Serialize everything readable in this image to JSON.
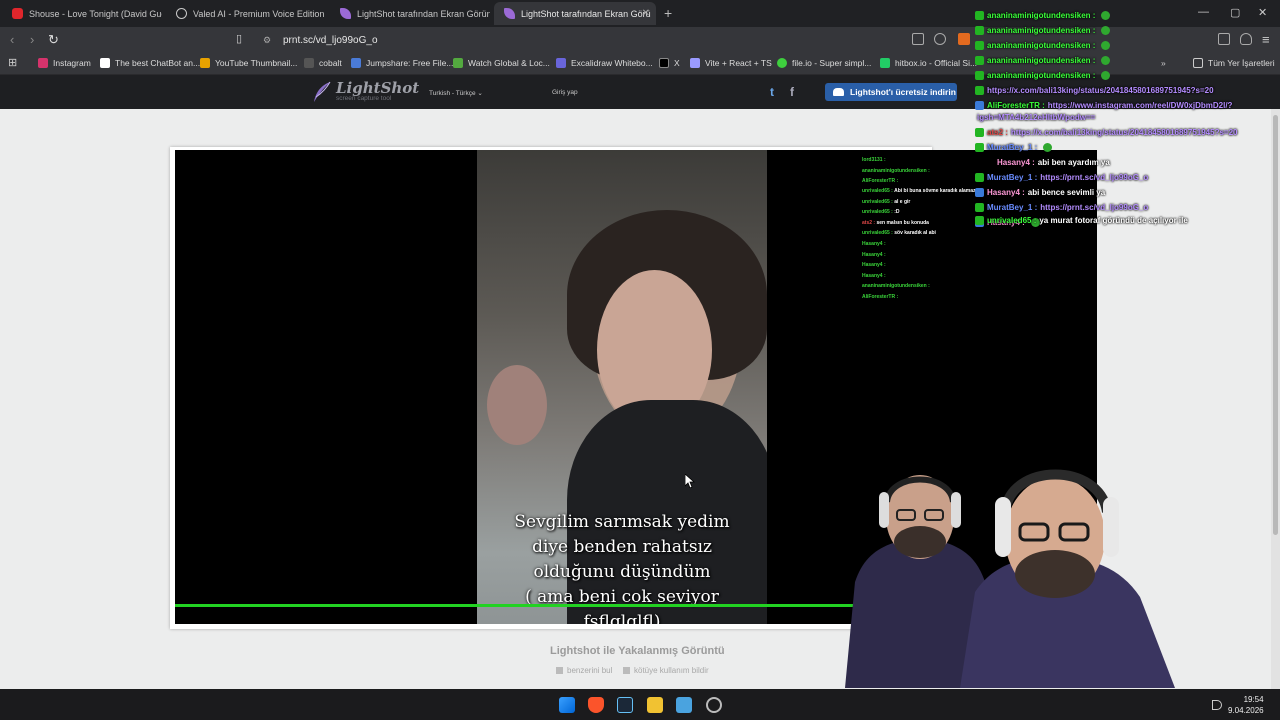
{
  "tabs": [
    {
      "title": "Shouse - Love Tonight (David Guetta",
      "color": "#e0262c"
    },
    {
      "title": "Valed AI - Premium Voice Edition",
      "color": "#c9c9c9"
    },
    {
      "title": "LightShot tarafından Ekran Görüntüs",
      "color": "#9b6ad6"
    },
    {
      "title": "LightShot tarafından Ekran Görü",
      "color": "#9b6ad6"
    }
  ],
  "url": "prnt.sc/vd_ljo99oG_o",
  "bookmarks": [
    {
      "label": "Instagram",
      "color": "#d6336c"
    },
    {
      "label": "The best ChatBot an...",
      "color": "#ffffff"
    },
    {
      "label": "YouTube Thumbnail...",
      "color": "#e8a200"
    },
    {
      "label": "cobalt",
      "color": "#222222"
    },
    {
      "label": "Jumpshare: Free File...",
      "color": "#4a7bd8"
    },
    {
      "label": "Watch Global & Loc...",
      "color": "#53a93f"
    },
    {
      "label": "Excalidraw Whitebo...",
      "color": "#6965db"
    },
    {
      "label": "X",
      "color": "#000000"
    },
    {
      "label": "Vite + React + TS",
      "color": "#9a9aff"
    },
    {
      "label": "file.io - Super simpl...",
      "color": "#3ecf3e"
    },
    {
      "label": "hitbox.io - Official Si...",
      "color": "#22cc66"
    }
  ],
  "all_bookmarks": "Tüm Yer İşaretleri",
  "lightshot": {
    "logo_name": "LightShot",
    "logo_tagline": "screen capture tool",
    "language": "Turkish - Türkçe",
    "login": "Giriş yap",
    "download": "Lightshot'ı ücretsiz indirin",
    "caption": "Lightshot ile Yakalanmış Görüntü",
    "similar": "benzerini bul",
    "report": "kötüye kullanım bildir"
  },
  "subtitle": [
    "Sevgilim sarımsak yedim",
    "diye benden rahatsız",
    "olduğunu düşündüm",
    "( ama beni cok seviyor",
    "fsflglglfl)"
  ],
  "mini_chat": [
    {
      "name": "lord3131 :"
    },
    {
      "name": "ananinaminigotundensiken :"
    },
    {
      "name": "AliForesterTR :"
    },
    {
      "name": "unrivaled65 :",
      "text": "Abi bi buna sövme karadık alamazsın"
    },
    {
      "name": "unrivaled65 :",
      "text": "al e gir"
    },
    {
      "name": "unrivaled65 :",
      "text": ":D"
    },
    {
      "name": "ats2 :",
      "text": "sen malsın bu konuda"
    },
    {
      "name": "unrivaled65 :",
      "text": "söv karadık al abi"
    },
    {
      "name": "Hasany4 :"
    },
    {
      "name": "Hasany4 :"
    },
    {
      "name": "Hasany4 :"
    },
    {
      "name": "Hasany4 :"
    },
    {
      "name": "ananinaminigotundensiken :"
    },
    {
      "name": "AliForesterTR :"
    }
  ],
  "chat": [
    {
      "name": "ananinaminigotundensiken :",
      "text": ""
    },
    {
      "name": "ananinaminigotundensiken :",
      "text": ""
    },
    {
      "name": "ananinaminigotundensiken :",
      "text": ""
    },
    {
      "name": "ananinaminigotundensiken :",
      "text": ""
    },
    {
      "name": "ananinaminigotundensiken :",
      "text": ""
    },
    {
      "name": "",
      "text": "https://x.com/bali13king/status/2041845801689751945?s=20"
    },
    {
      "name": "AliForesterTR :",
      "text": "https://www.instagram.com/reel/DW0xjDbmD2l/?"
    },
    {
      "name": "",
      "text": "igsh=MTA4b212eHltbWpodw=="
    },
    {
      "name": "ats2 :",
      "text": "https://x.com/bali13king/status/2041845801689751945?s=20"
    },
    {
      "name": "MuratBey_1 :",
      "text": ""
    },
    {
      "name": "Hasany4 :",
      "text": "abi ben ayardım ya"
    },
    {
      "name": "MuratBey_1 :",
      "text": "https://prnt.sc/vd_ljo99oG_o"
    },
    {
      "name": "Hasany4 :",
      "text": "abi bence sevimli ya"
    },
    {
      "name": "MuratBey_1 :",
      "text": "https://prnt.sc/vd_ljo99oG_o"
    },
    {
      "name": "Hasany4 :",
      "text": ""
    },
    {
      "name": "unrivaled65 :",
      "text": "ya murat fotoraf göründü de açılıyor ile"
    }
  ],
  "clock": {
    "time": "19:54",
    "date": "9.04.2026"
  }
}
